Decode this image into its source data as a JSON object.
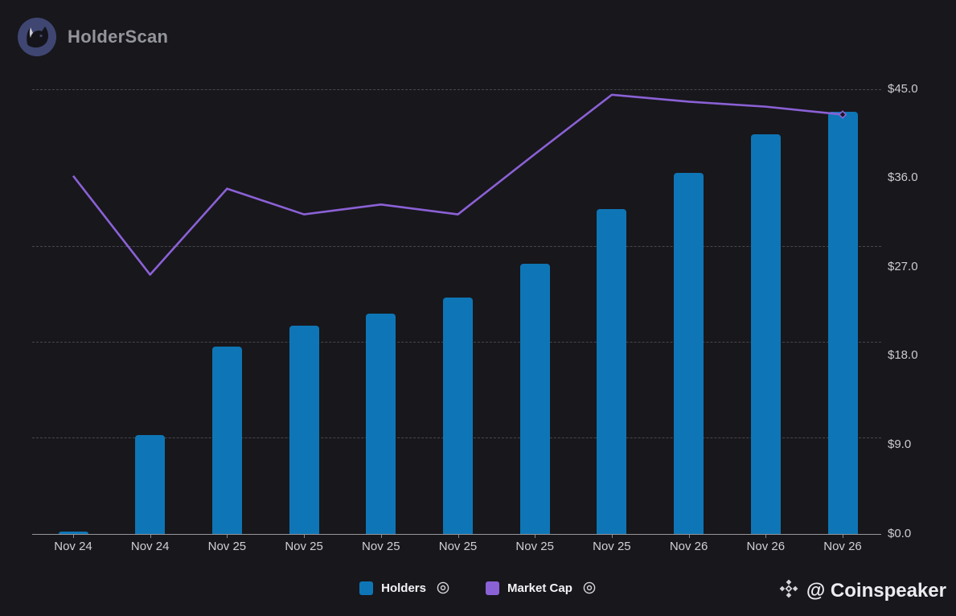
{
  "header": {
    "app_name": "HolderScan"
  },
  "icons": {
    "app_logo": "cat-logo-icon",
    "legend_visibility": "eye-icon",
    "credit_logo": "binance-diamond-icon"
  },
  "colors": {
    "background": "#18171c",
    "bar_blue": "#0e76b6",
    "line_purple": "#8b61d6",
    "grid": "#47474d",
    "axis_text": "#cbccd0",
    "legend_text": "#f4f4f6"
  },
  "legend": {
    "items": [
      {
        "label": "Holders",
        "color": "#0e76b6",
        "type": "bar"
      },
      {
        "label": "Market Cap",
        "color": "#8b61d6",
        "type": "line"
      }
    ]
  },
  "credit": {
    "text": "@ Coinspeaker"
  },
  "chart_data": {
    "type": "bar+line combo",
    "categories": [
      "Nov 24",
      "Nov 24",
      "Nov 25",
      "Nov 25",
      "Nov 25",
      "Nov 25",
      "Nov 25",
      "Nov 25",
      "Nov 26",
      "Nov 26",
      "Nov 26"
    ],
    "series": [
      {
        "name": "Holders",
        "type": "bar",
        "axis": "left-hidden",
        "color": "#0e76b6",
        "values": [
          200,
          10300,
          19500,
          21700,
          22900,
          24600,
          28100,
          33800,
          37600,
          41600,
          44000
        ]
      },
      {
        "name": "Market Cap",
        "type": "line",
        "axis": "right",
        "color": "#8b61d6",
        "values": [
          36.2,
          26.2,
          34.9,
          32.3,
          33.3,
          32.3,
          38.4,
          44.4,
          43.7,
          43.2,
          42.4
        ]
      }
    ],
    "right_axis": {
      "tick_labels": [
        "$45.0",
        "$36.0",
        "$27.0",
        "$18.0",
        "$9.0",
        "$0.0"
      ],
      "tick_values": [
        45,
        36,
        27,
        18,
        9,
        0
      ],
      "min": 0,
      "max": 45
    },
    "left_axis": {
      "labels_visible": false,
      "gridline_values": [
        10000,
        20000,
        30000
      ]
    },
    "dollar_gridlines": [
      45
    ],
    "grid": "horizontal dashed",
    "legend_position": "bottom-center",
    "line_end_marker": "small-diamond"
  }
}
